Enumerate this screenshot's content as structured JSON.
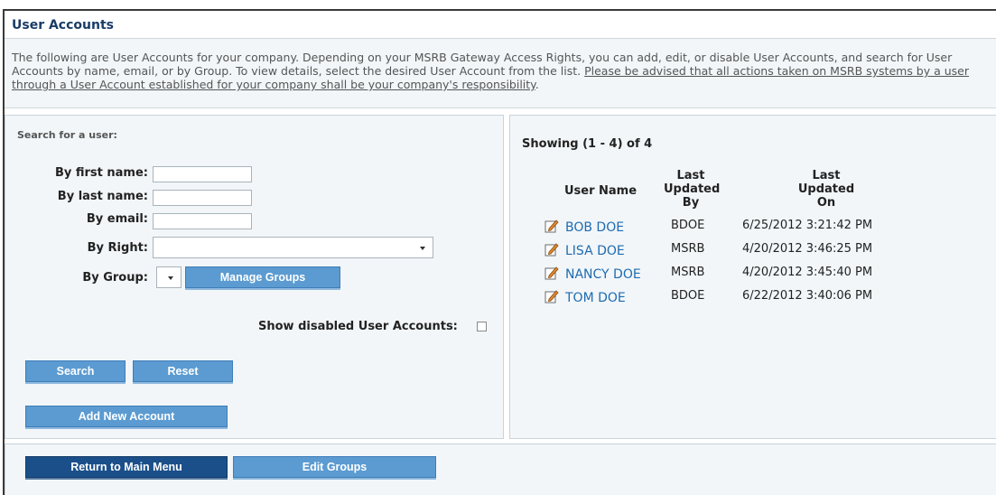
{
  "page": {
    "title": "User Accounts",
    "intro_text": "The following are User Accounts for your company. Depending on your MSRB Gateway Access Rights, you can add, edit, or disable User Accounts, and search for User Accounts by name, email, or by Group. To view details, select the desired User Account from the list. ",
    "intro_link": "Please be advised that all actions taken on MSRB systems by a user through a User Account established for your company shall be your company's responsibility",
    "intro_tail": "."
  },
  "search": {
    "heading": "Search for a user:",
    "first_name_label": "By first name:",
    "first_name_value": "",
    "last_name_label": "By last name:",
    "last_name_value": "",
    "email_label": "By email:",
    "email_value": "",
    "right_label": "By Right:",
    "right_value": "",
    "group_label": "By Group:",
    "group_value": "",
    "manage_groups_button": "Manage Groups",
    "show_disabled_label": "Show disabled User Accounts:",
    "show_disabled_checked": false,
    "search_button": "Search",
    "reset_button": "Reset",
    "add_account_button": "Add New Account"
  },
  "results": {
    "showing": "Showing (1 - 4) of 4",
    "headers": {
      "user_name": "User Name",
      "last_updated_by": [
        "Last",
        "Updated",
        "By"
      ],
      "last_updated_on": [
        "Last",
        "Updated",
        "On"
      ]
    },
    "rows": [
      {
        "name": "BOB DOE",
        "updated_by": "BDOE",
        "updated_on": "6/25/2012 3:21:42 PM"
      },
      {
        "name": "LISA DOE",
        "updated_by": "MSRB",
        "updated_on": "4/20/2012 3:46:25 PM"
      },
      {
        "name": "NANCY DOE",
        "updated_by": "MSRB",
        "updated_on": "4/20/2012 3:45:40 PM"
      },
      {
        "name": "TOM DOE",
        "updated_by": "BDOE",
        "updated_on": "6/22/2012 3:40:06 PM"
      }
    ],
    "row_icon": "edit-pencil-icon"
  },
  "footer": {
    "return_button": "Return to Main Menu",
    "edit_groups_button": "Edit Groups"
  },
  "colors": {
    "title": "#1a3b66",
    "panel_bg": "#f2f6f9",
    "button": "#5b9bd1",
    "button_dark": "#1a4f8a",
    "link": "#1e6bb0"
  }
}
